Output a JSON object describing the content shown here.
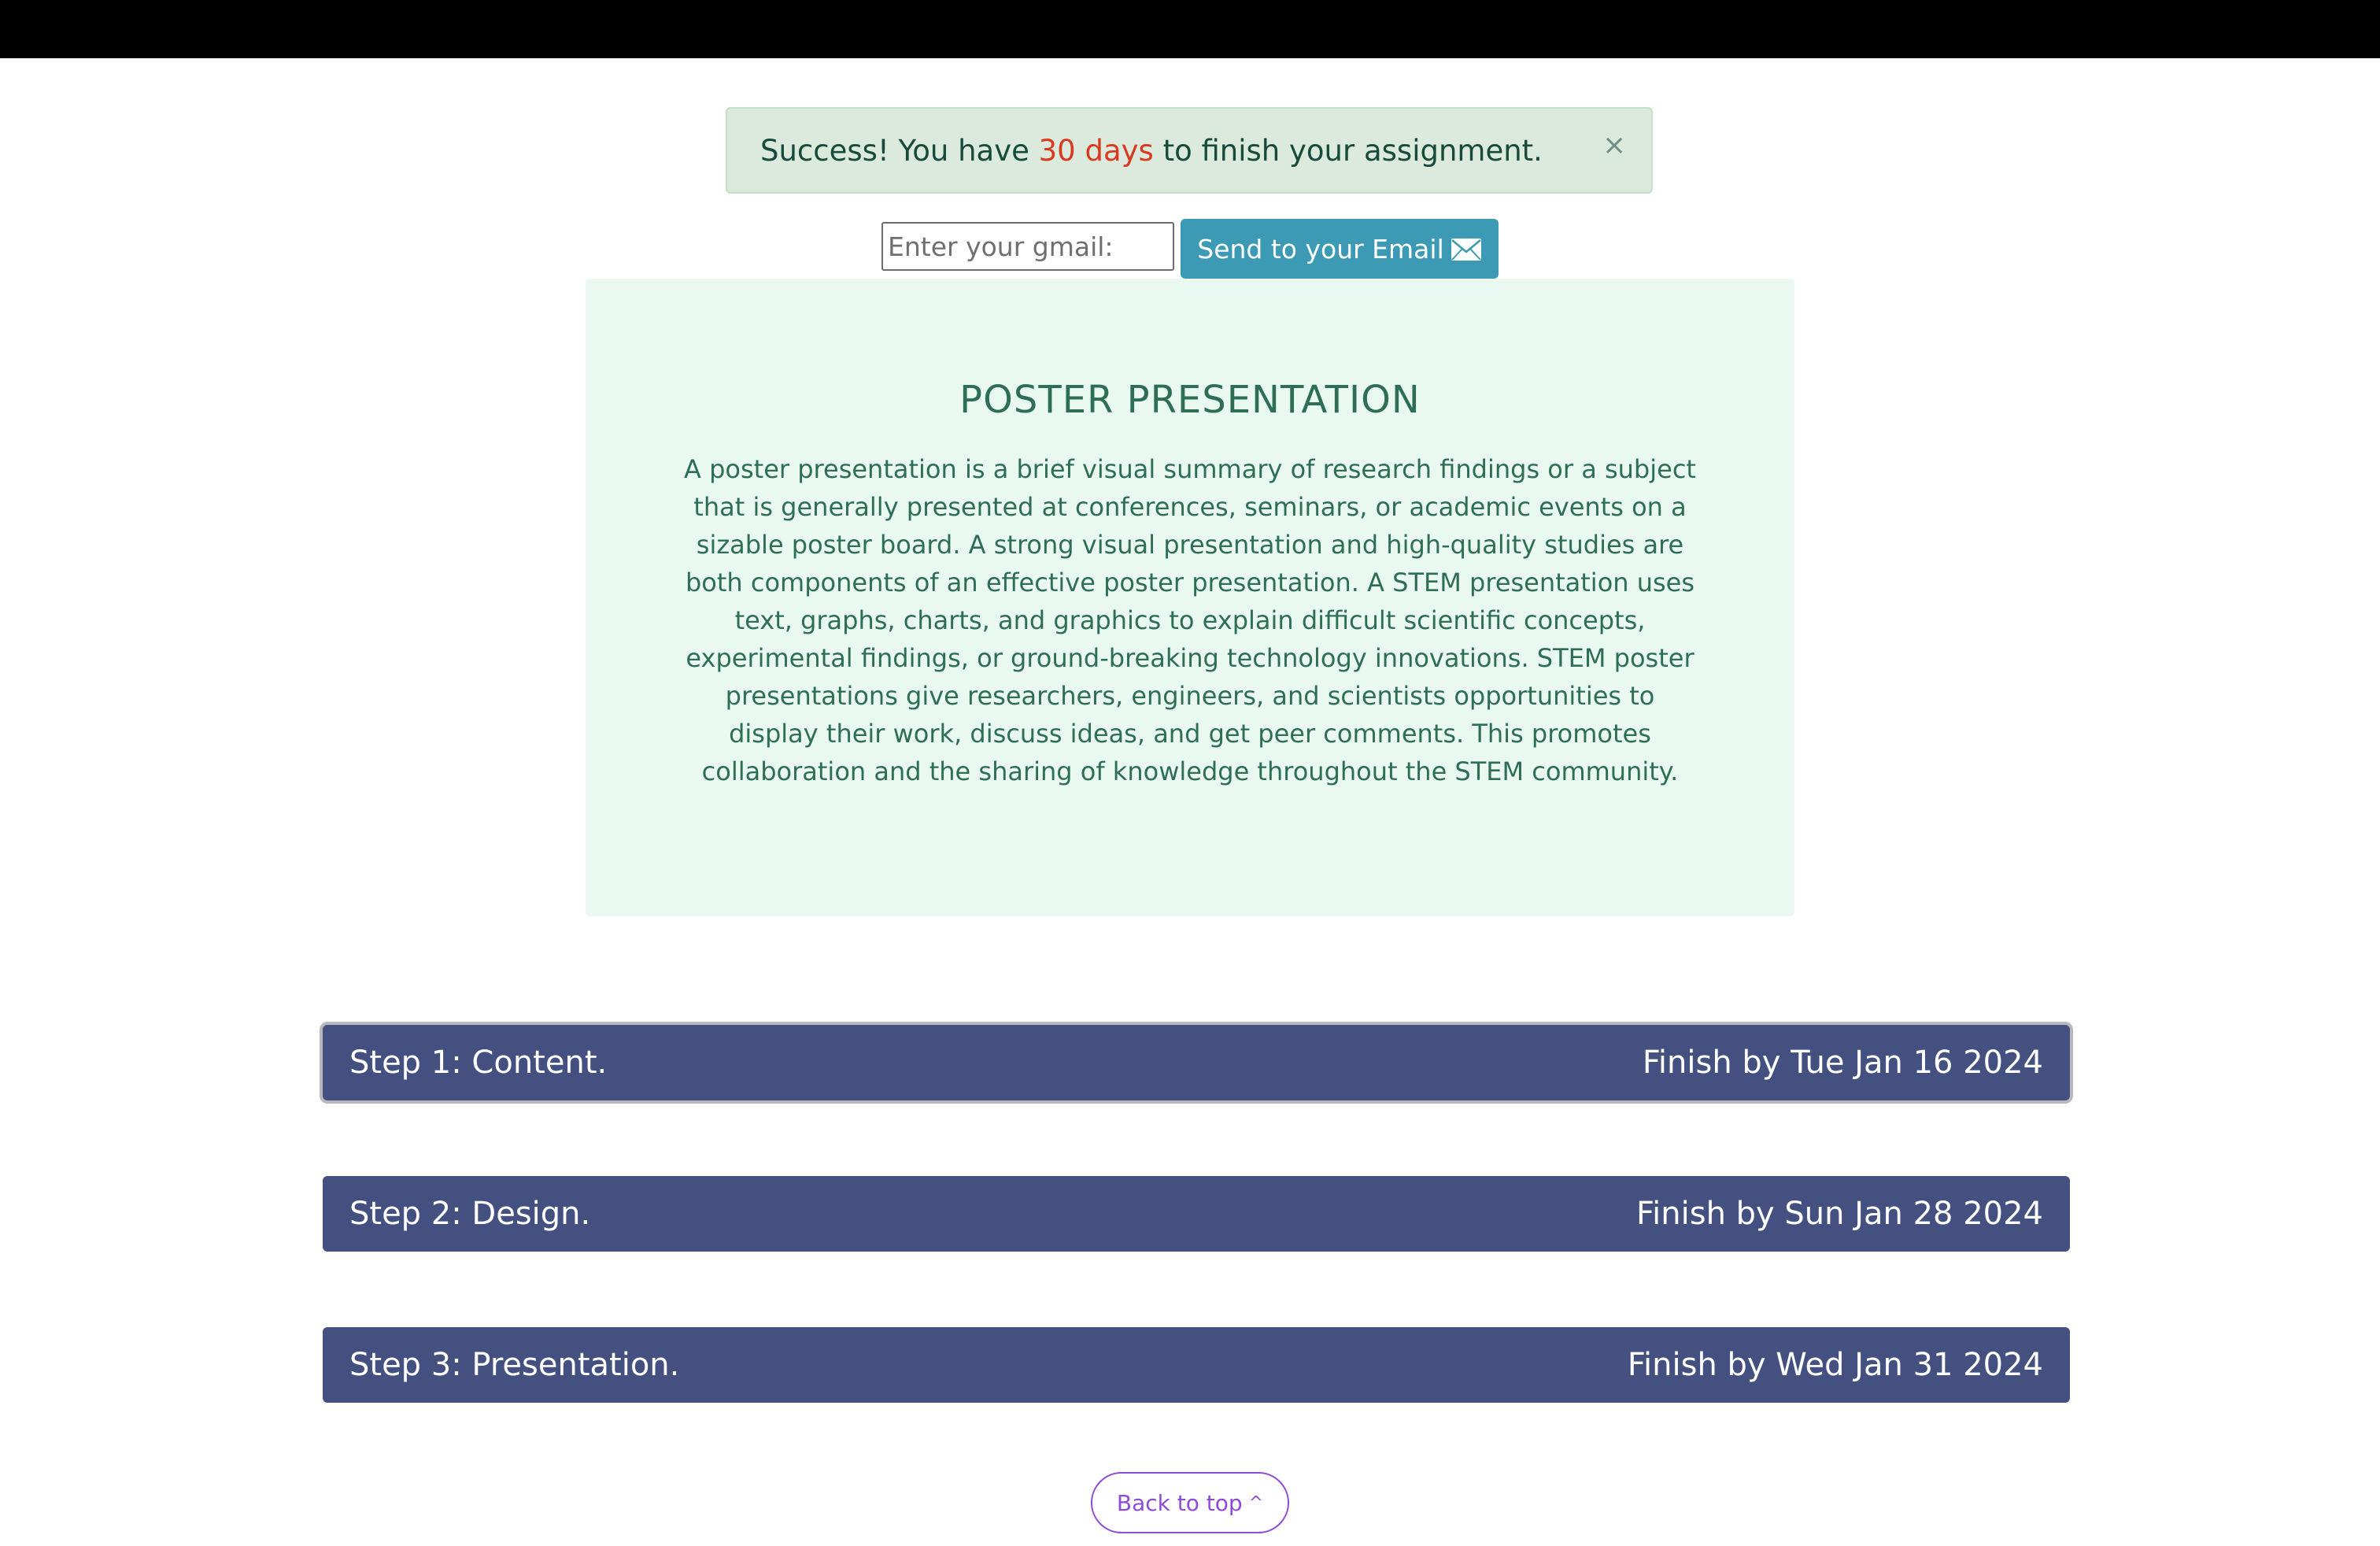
{
  "alert": {
    "prefix": "Success! You have ",
    "days": "30 days",
    "suffix": " to finish your assignment.",
    "close": "×"
  },
  "email": {
    "placeholder": "Enter your gmail:",
    "value": "",
    "send_label": "Send to your Email",
    "send_icon": "envelope-icon"
  },
  "card": {
    "title": "POSTER PRESENTATION",
    "body": "A poster presentation is a brief visual summary of research findings or a subject that is generally presented at conferences, seminars, or academic events on a sizable poster board. A strong visual presentation and high-quality studies are both components of an effective poster presentation. A STEM presentation uses text, graphs, charts, and graphics to explain difficult scientific concepts, experimental findings, or ground-breaking technology innovations. STEM poster presentations give researchers, engineers, and scientists opportunities to display their work, discuss ideas, and get peer comments. This promotes collaboration and the sharing of knowledge throughout the STEM community."
  },
  "steps": [
    {
      "label": "Step 1: Content.",
      "deadline": "Finish by Tue Jan 16 2024"
    },
    {
      "label": "Step 2: Design.",
      "deadline": "Finish by Sun Jan 28 2024"
    },
    {
      "label": "Step 3: Presentation.",
      "deadline": "Finish by Wed Jan 31 2024"
    }
  ],
  "back_to_top": {
    "label": "Back to top",
    "arrow": "^"
  },
  "colors": {
    "alert_bg": "#dce9dd",
    "alert_text": "#164a3b",
    "alert_highlight": "#d93a1f",
    "send_button": "#3c9ab5",
    "card_bg": "#e9f9f1",
    "card_text": "#2e6e55",
    "step_bg": "#44507f",
    "back_to_top": "#8d4bd6"
  }
}
